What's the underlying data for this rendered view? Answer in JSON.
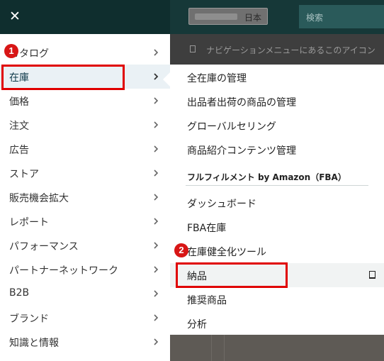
{
  "background": {
    "marketplace_label": "日本",
    "search_placeholder": "検索",
    "info_bar_text": "ナビゲーションメニューにあるこのアイコン"
  },
  "left_menu": {
    "close_icon": "close-icon",
    "items": [
      {
        "label": "カタログ"
      },
      {
        "label": "在庫"
      },
      {
        "label": "価格"
      },
      {
        "label": "注文"
      },
      {
        "label": "広告"
      },
      {
        "label": "ストア"
      },
      {
        "label": "販売機会拡大"
      },
      {
        "label": "レポート"
      },
      {
        "label": "パフォーマンス"
      },
      {
        "label": "パートナーネットワーク"
      },
      {
        "label": "B2B"
      },
      {
        "label": "ブランド"
      },
      {
        "label": "知識と情報"
      }
    ]
  },
  "submenu": {
    "items_top": [
      {
        "label": "全在庫の管理"
      },
      {
        "label": "出品者出荷の商品の管理"
      },
      {
        "label": "グローバルセリング"
      },
      {
        "label": "商品紹介コンテンツ管理"
      }
    ],
    "fba_header": "フルフィルメント by Amazon（FBA）",
    "items_fba": [
      {
        "label": "ダッシュボード"
      },
      {
        "label": "FBA在庫"
      },
      {
        "label": "在庫健全化ツール"
      },
      {
        "label": "納品"
      },
      {
        "label": "推奨商品"
      },
      {
        "label": "分析"
      }
    ]
  },
  "annotations": {
    "badge1": "1",
    "badge2": "2",
    "color": "#e00000"
  }
}
